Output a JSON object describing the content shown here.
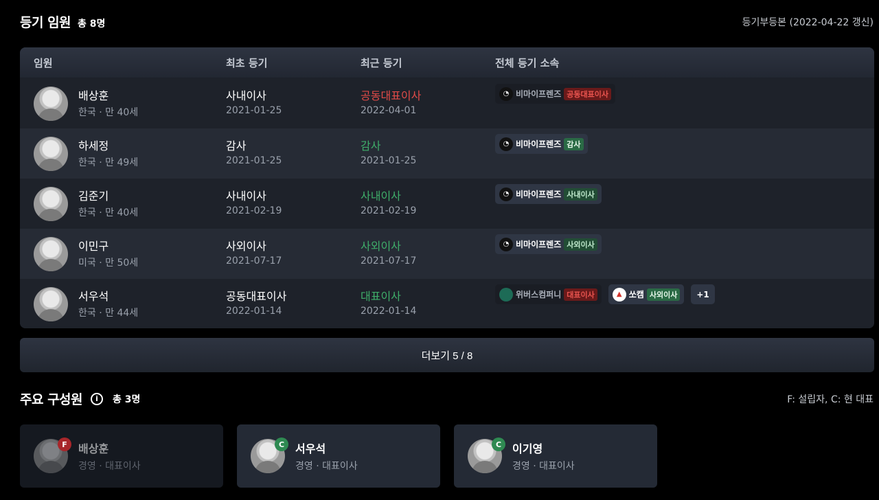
{
  "officers": {
    "title": "등기 임원",
    "count": "총 8명",
    "source": "등기부등본 (2022-04-22 갱신)",
    "headers": [
      "임원",
      "최초 등기",
      "최근 등기",
      "전체 등기 소속"
    ],
    "rows": [
      {
        "name": "배상훈",
        "meta": "한국 · 만 40세",
        "first": "사내이사",
        "first_date": "2021-01-25",
        "recent": "공동대표이사",
        "recent_date": "2022-04-01",
        "recent_color": "#e14b48",
        "aff": [
          {
            "company": "비마이프렌즈",
            "role": "공동대표이사",
            "style": "red"
          }
        ]
      },
      {
        "name": "하세정",
        "meta": "한국 · 만 49세",
        "first": "감사",
        "first_date": "2021-01-25",
        "recent": "감사",
        "recent_date": "2021-01-25",
        "recent_color": "#3fae6a",
        "aff": [
          {
            "company": "비마이프렌즈",
            "role": "감사",
            "style": "green"
          }
        ]
      },
      {
        "name": "김준기",
        "meta": "한국 · 만 40세",
        "first": "사내이사",
        "first_date": "2021-02-19",
        "recent": "사내이사",
        "recent_date": "2021-02-19",
        "recent_color": "#3fae6a",
        "aff": [
          {
            "company": "비마이프렌즈",
            "role": "사내이사",
            "style": "green"
          }
        ]
      },
      {
        "name": "이민구",
        "meta": "미국 · 만 50세",
        "first": "사외이사",
        "first_date": "2021-07-17",
        "recent": "사외이사",
        "recent_date": "2021-07-17",
        "recent_color": "#3fae6a",
        "aff": [
          {
            "company": "비마이프렌즈",
            "role": "사외이사",
            "style": "green"
          }
        ]
      },
      {
        "name": "서우석",
        "meta": "한국 · 만 44세",
        "first": "공동대표이사",
        "first_date": "2022-01-14",
        "recent": "대표이사",
        "recent_date": "2022-01-14",
        "recent_color": "#3fae6a",
        "aff": [
          {
            "company": "위버스컴퍼니",
            "role": "대표이사",
            "style": "red"
          },
          {
            "company": "쏘캠",
            "role": "사외이사",
            "style": "green"
          }
        ],
        "extra": "+1"
      }
    ],
    "more_label": "더보기 5 / 8"
  },
  "members": {
    "title": "주요 구성원",
    "info_icon": "i",
    "count": "총 3명",
    "legend": "F: 설립자, C: 현 대표",
    "cards": [
      {
        "name": "배상훈",
        "role": "경영 · 대표이사",
        "badge": "F"
      },
      {
        "name": "서우석",
        "role": "경영 · 대표이사",
        "badge": "C"
      },
      {
        "name": "이기영",
        "role": "경영 · 대표이사",
        "badge": "C"
      }
    ]
  }
}
